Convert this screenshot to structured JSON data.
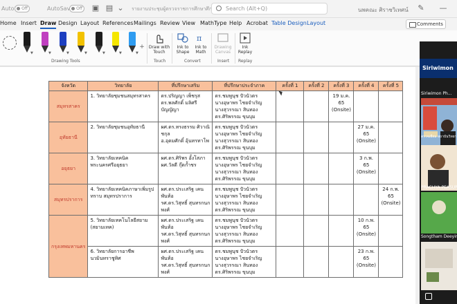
{
  "titlebar": {
    "autosave_label_1": "AutoSave",
    "toggle_1": "Off",
    "autosave_label_2": "AutoSave",
    "toggle_2": "Off",
    "doc_title": "รายงานประชุมผู้ตรวจราชการศึกษาศึกษาเจ้าที่ 21 • Word",
    "search_placeholder": "Search (Alt+Q)",
    "user_name": "นพคณะ ศิราชวิเทศน์"
  },
  "menu": {
    "items": [
      "Home",
      "Insert",
      "Draw",
      "Design",
      "Layout",
      "References",
      "Mailings",
      "Review",
      "View",
      "MathType",
      "Help",
      "Acrobat",
      "Table Design",
      "Layout"
    ],
    "active_index": 2,
    "comments_label": "Comments"
  },
  "ribbon": {
    "drawing_tools_label": "Drawing Tools",
    "touch_label": "Touch",
    "convert_label": "Convert",
    "insert_label": "Insert",
    "replay_label": "Replay",
    "draw_with_touch": "Draw with Touch",
    "ink_to_shape": "Ink to Shape",
    "ink_to_math": "Ink to Math",
    "drawing_canvas": "Drawing Canvas",
    "ink_replay": "Ink Replay",
    "pen_colors": [
      "#1a1a1a",
      "#c040c0",
      "#1d3fc0",
      "#f2c200",
      "#1e1e1e",
      "#f5e600",
      "#2f9cf0"
    ]
  },
  "table": {
    "headers": [
      "จังหวัด",
      "วิทยาลัย",
      "ที่ปรึกษาเสริม",
      "ที่ปรึกษาประจำภาค",
      "ครั้งที่ 1",
      "ครั้งที่ 2",
      "ครั้งที่ 3",
      "ครั้งที่ 4",
      "ครั้งที่ 5"
    ],
    "rows": [
      {
        "province": "สมุทรสาคร",
        "college": "1. วิทยาลัยชุมชนสมุทรสาคร",
        "advisor": [
          "ดร.ปริญญา เพ็ชรุส",
          "ดร.พลศักดิ์ มลิศรีบัญญัญา"
        ],
        "regional": [
          "ดร.ชมพูนุช ปัวนัวตร",
          "นางอุษาพร ไชยจำเริญ",
          "นางสุวรรณา สินทอง",
          "ดร.ศิริพรรณ ขุนบุม"
        ],
        "r1": "",
        "r2": "",
        "r3": "19 ม.ค. 65 (Onsite)",
        "r4": "",
        "r5": ""
      },
      {
        "province": "อุทัยธานี",
        "college": "2. วิทยาลัยชุมชนอุทัยธานี",
        "advisor": [
          "ผศ.ดร.ทรงธรรม ศิวาณิชกุล",
          "อ.อุดมศักดิ์ อุ้นทรทาโพ"
        ],
        "regional": [
          "ดร.ชมพูนุช ปัวนัวตร",
          "นางอุษาพร ไชยจำเริญ",
          "นางสุวรรณา สินทอง",
          "ดร.ศิริพรรณ ขุนบุม"
        ],
        "r1": "",
        "r2": "",
        "r3": "",
        "r4": "27 ม.ค. 65 (Onsite)",
        "r5": ""
      },
      {
        "province": "อยุธยา",
        "college": "3. วิทยาลัยเทคนิคพระนครศรีอยุธยา",
        "advisor": [
          "ผศ.ดร.ศิริพร อั้งโสภา",
          "ผศ.วัลดี กุ๊ดก้ำชร"
        ],
        "regional": [
          "ดร.ชมพูนุช ปัวนัวตร",
          "นางอุษาพร ไชยจำเริญ",
          "นางสุวรรณา สินทอง",
          "ดร.ศิริพรรณ ขุนบุม"
        ],
        "r1": "",
        "r2": "",
        "r3": "",
        "r4": "3 ก.พ. 65 (Onsite)",
        "r5": ""
      },
      {
        "province": "สมุทรปราการ",
        "college": "4. วิทยาลัยเทคนิคภาษาเพิ่มรูปทราบ สมุทรปราการ",
        "advisor": [
          "ผศ.ดร.ประเสริฐ เคนพันท้อ",
          "รศ.ดร.วิสุทธิ์ สุนทรกนกพงศ์"
        ],
        "regional": [
          "ดร.ชมพูนุช ปัวนัวตร",
          "นางอุษาพร ไชยจำเริญ",
          "นางสุวรรณา สินทอง",
          "ดร.ศิริพรรณ ขุนบุม"
        ],
        "r1": "",
        "r2": "",
        "r3": "",
        "r4": "",
        "r5": "24 ก.พ. 65 (Onsite)"
      },
      {
        "province": "กรุงเทพมหานคร",
        "college": "5. วิทยาลัยเทคโนโลยีสยาม (สยามเทค)",
        "advisor": [
          "ผศ.ดร.ประเสริฐ เคนพันท้อ",
          "รศ.ดร.วิสุทธิ์ สุนทรกนกพงศ์"
        ],
        "regional": [
          "ดร.ชมพูนุช ปัวนัวตร",
          "นางอุษาพร ไชยจำเริญ",
          "นางสุวรรณา สินทอง",
          "ดร.ศิริพรรณ ขุนบุม"
        ],
        "r1": "",
        "r2": "",
        "r3": "",
        "r4": "10 ก.พ. 65 (Onsite)",
        "r5": ""
      },
      {
        "province": "",
        "college": "6. วิทยาลัยการอาชีพนวมินทราชูทิศ",
        "advisor": [
          "ผศ.ดร.ประเสริฐ เคนพันท้อ",
          "รศ.ดร.วิสุทธิ์ สุนทรกนกพงศ์"
        ],
        "regional": [
          "ดร.ชมพูนุช ปัวนัวตร",
          "นางอุษาพร ไชยจำเริญ",
          "นางสุวรรณา สินทอง",
          "ดร.ศิริพรรณ ขุนบุม"
        ],
        "r1": "",
        "r2": "",
        "r3": "",
        "r4": "23 ก.พ. 65 (Onsite)",
        "r5": ""
      }
    ]
  },
  "zoom_panel": {
    "banner_name": "Siriwimon",
    "participant_1": "Siriwimon Ph...",
    "participant_2": "PRACHYA PEASUPA",
    "participant_3": "Songtham Deeying",
    "sign_text": "ตรวจเยี่ยม สถาบันวิทยาลัยชุมชน"
  }
}
